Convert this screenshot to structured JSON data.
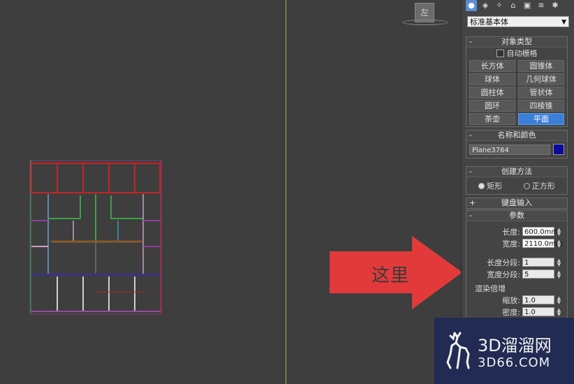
{
  "viewport": {
    "viewcube_label": "左"
  },
  "toolbar": {
    "icons": [
      "sphere-icon",
      "shapes-icon",
      "light-icon",
      "camera-icon",
      "helper-icon",
      "spacewarp-icon",
      "systems-icon"
    ]
  },
  "panel": {
    "category_select": "标准基本体",
    "object_type": {
      "title": "对象类型",
      "autogrid_label": "自动栅格",
      "buttons": [
        "长方体",
        "圆锥体",
        "球体",
        "几何球体",
        "圆柱体",
        "管状体",
        "圆环",
        "四棱锥",
        "茶壶",
        "平面"
      ],
      "selected": "平面"
    },
    "name_color": {
      "title": "名称和颜色",
      "name_value": "Plane3764",
      "color": "#0b0b9c"
    },
    "creation_method": {
      "title": "创建方法",
      "option1": "矩形",
      "option2": "正方形"
    },
    "keyboard_entry": {
      "title": "键盘输入",
      "sign": "+"
    },
    "parameters": {
      "title": "参数",
      "length_label": "长度:",
      "length_value": "600.0mm",
      "width_label": "宽度:",
      "width_value": "2110.0mm",
      "length_segs_label": "长度分段:",
      "length_segs_value": "1",
      "width_segs_label": "宽度分段:",
      "width_segs_value": "5",
      "render_group": "渲染倍增",
      "scale_label": "缩放:",
      "scale_value": "1.0",
      "density_label": "密度:",
      "density_value": "1.0"
    },
    "minus_sign": "-"
  },
  "annotation": {
    "arrow_text": "这里",
    "arrow_color": "#e23a3a"
  },
  "watermark": {
    "title": "3D溜溜网",
    "subtitle": "3D66.COM"
  }
}
